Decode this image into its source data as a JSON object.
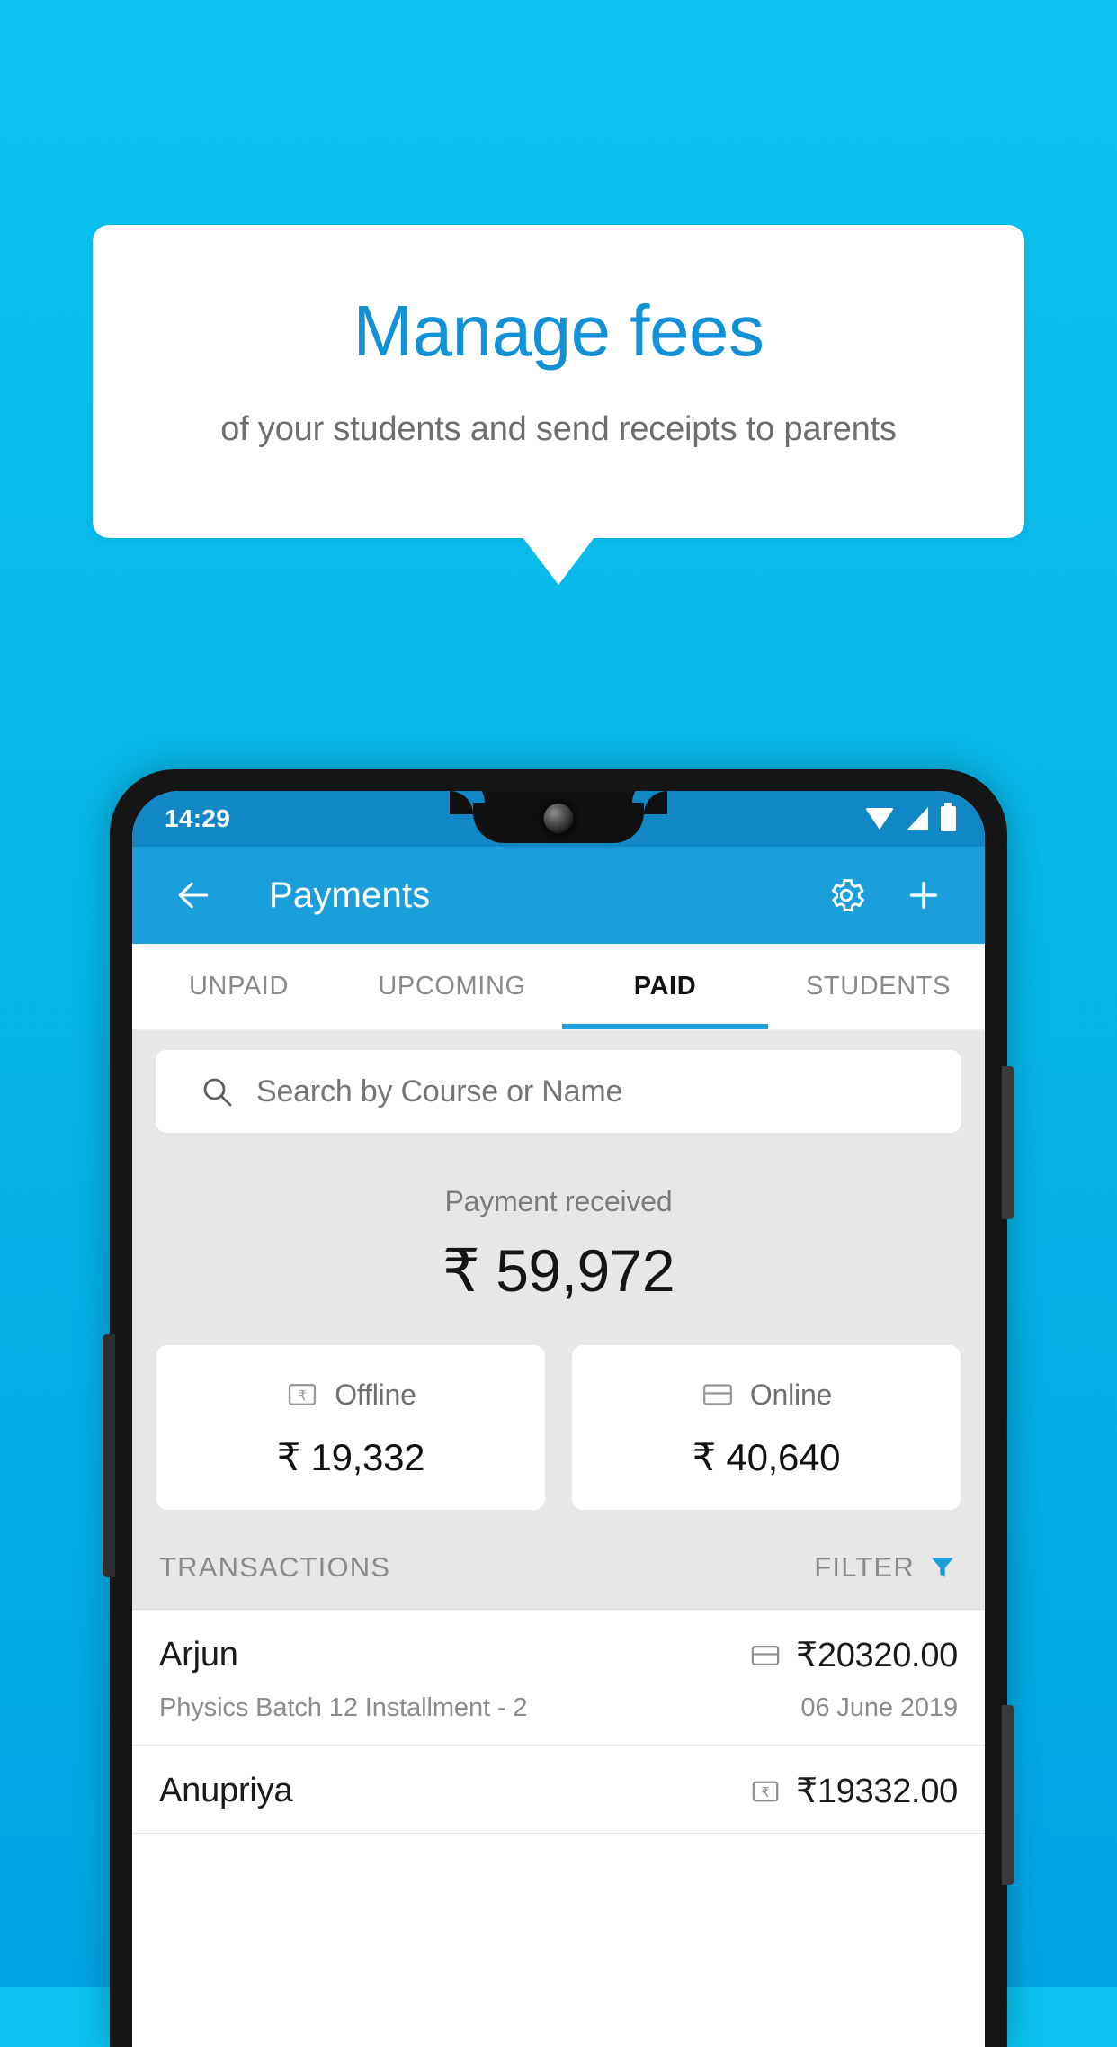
{
  "promo": {
    "title": "Manage fees",
    "subtitle": "of your students and send receipts to parents"
  },
  "colors": {
    "background_top": "#0ac3f0",
    "background_bottom": "#00a5e4",
    "brand": "#1b9fdb",
    "title_blue": "#1391d7",
    "statusbar": "#1287c6",
    "filter_icon": "#1b9fdb"
  },
  "phone": {
    "statusbar": {
      "time": "14:29",
      "icons": [
        "wifi-icon",
        "signal-icon",
        "battery-icon"
      ]
    },
    "appbar": {
      "back_icon": "back-arrow-icon",
      "title": "Payments",
      "settings_icon": "gear-icon",
      "add_icon": "plus-icon"
    },
    "tabs": [
      {
        "label": "UNPAID",
        "active": false
      },
      {
        "label": "UPCOMING",
        "active": false
      },
      {
        "label": "PAID",
        "active": true
      },
      {
        "label": "STUDENTS",
        "active": false
      }
    ],
    "search": {
      "icon": "search-icon",
      "placeholder": "Search by Course or Name",
      "value": ""
    },
    "summary": {
      "label": "Payment received",
      "amount": "₹ 59,972",
      "breakdown": [
        {
          "icon": "cash-note-icon",
          "label": "Offline",
          "amount": "₹ 19,332"
        },
        {
          "icon": "credit-card-icon",
          "label": "Online",
          "amount": "₹ 40,640"
        }
      ]
    },
    "transactions_section": {
      "title": "TRANSACTIONS",
      "filter_label": "FILTER",
      "filter_icon": "funnel-icon"
    },
    "transactions": [
      {
        "name": "Arjun",
        "method_icon": "credit-card-icon",
        "amount": "₹20320.00",
        "description": "Physics Batch 12 Installment - 2",
        "date": "06 June 2019"
      },
      {
        "name": "Anupriya",
        "method_icon": "cash-note-icon",
        "amount": "₹19332.00",
        "description": "",
        "date": ""
      }
    ]
  }
}
